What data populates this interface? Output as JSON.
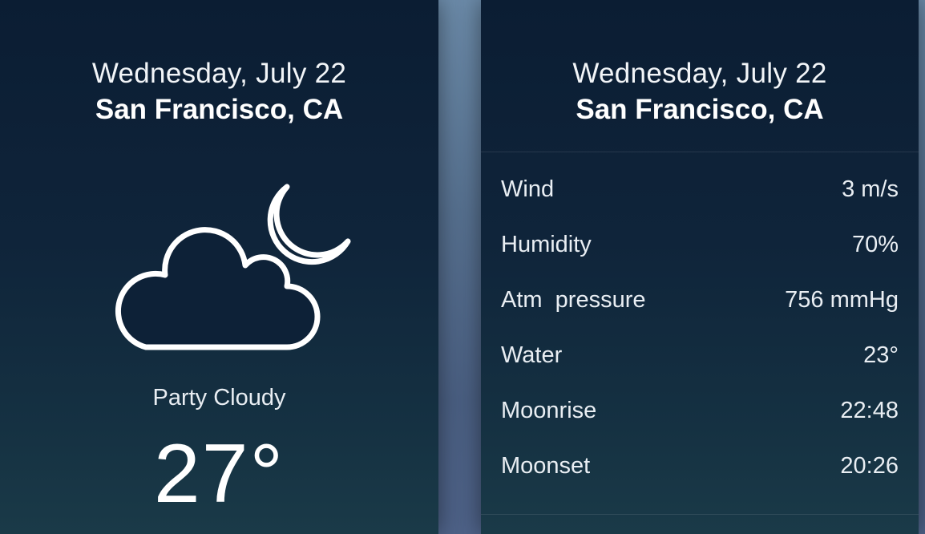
{
  "left_card": {
    "date": "Wednesday, July 22",
    "city": "San Francisco, CA",
    "icon": "cloud-moon-icon",
    "condition": "Party Cloudy",
    "temperature": "27°"
  },
  "right_card": {
    "date": "Wednesday, July 22",
    "city": "San Francisco, CA",
    "stats": [
      {
        "label": "Wind",
        "value": "3 m/s"
      },
      {
        "label": "Humidity",
        "value": "70%"
      },
      {
        "label": "Atm  pressure",
        "value": "756 mmHg"
      },
      {
        "label": "Water",
        "value": "23°"
      },
      {
        "label": "Moonrise",
        "value": "22:48"
      },
      {
        "label": "Moonset",
        "value": "20:26"
      }
    ]
  },
  "colors": {
    "card_top": "#0b1d33",
    "card_bottom": "#1a3a48",
    "background": "#56708f",
    "text": "#ffffff"
  }
}
